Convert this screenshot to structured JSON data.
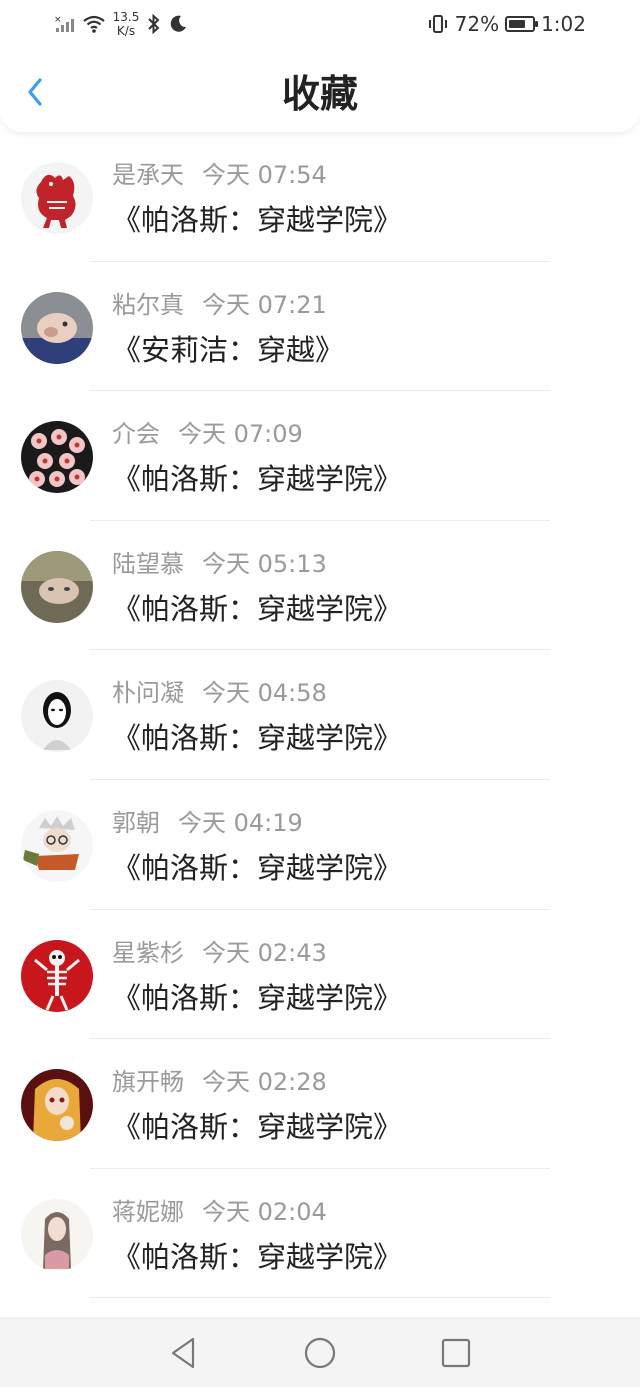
{
  "status": {
    "net_speed_value": "13.5",
    "net_speed_unit": "K/s",
    "battery_percent": 72,
    "battery_text": "72%",
    "time": "1:02"
  },
  "header": {
    "title": "收藏"
  },
  "colors": {
    "accent": "#3a9ff0",
    "meta_text": "#9a9a9a",
    "title_text": "#222222"
  },
  "favorites": [
    {
      "name": "是承天",
      "time": "今天 07:54",
      "book": "《帕洛斯：穿越学院》",
      "avatar_icon": "paper-cut-rooster-avatar"
    },
    {
      "name": "粘尔真",
      "time": "今天 07:21",
      "book": "《安莉洁：穿越》",
      "avatar_icon": "dog-photo-avatar"
    },
    {
      "name": "介会",
      "time": "今天 07:09",
      "book": "《帕洛斯：穿越学院》",
      "avatar_icon": "flowers-avatar"
    },
    {
      "name": "陆望慕",
      "time": "今天 05:13",
      "book": "《帕洛斯：穿越学院》",
      "avatar_icon": "portrait-avatar"
    },
    {
      "name": "朴问凝",
      "time": "今天 04:58",
      "book": "《帕洛斯：穿越学院》",
      "avatar_icon": "masked-person-avatar"
    },
    {
      "name": "郭朝",
      "time": "今天 04:19",
      "book": "《帕洛斯：穿越学院》",
      "avatar_icon": "anime-character-avatar"
    },
    {
      "name": "星紫杉",
      "time": "今天 02:43",
      "book": "《帕洛斯：穿越学院》",
      "avatar_icon": "skeleton-avatar"
    },
    {
      "name": "旗开畅",
      "time": "今天 02:28",
      "book": "《帕洛斯：穿越学院》",
      "avatar_icon": "anime-girl-avatar"
    },
    {
      "name": "蒋妮娜",
      "time": "今天 02:04",
      "book": "《帕洛斯：穿越学院》",
      "avatar_icon": "drawing-girl-avatar"
    }
  ],
  "nav": {
    "back": "back-triangle-icon",
    "home": "home-circle-icon",
    "recent": "recent-square-icon"
  }
}
